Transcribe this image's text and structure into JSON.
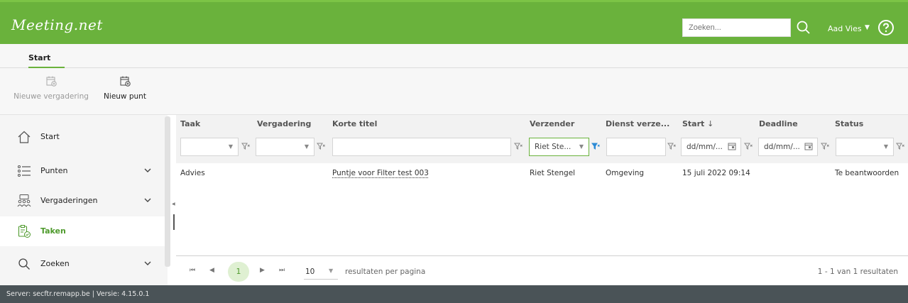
{
  "header": {
    "logo": "Meeting.net",
    "search_placeholder": "Zoeken...",
    "user_name": "Aad Vies",
    "brand_color": "#6ab23c"
  },
  "ribbon": {
    "tab": "Start",
    "buttons": [
      {
        "label": "Nieuwe vergadering",
        "enabled": false,
        "icon": "calendar-add-icon"
      },
      {
        "label": "Nieuw punt",
        "enabled": true,
        "icon": "calendar-add-icon"
      }
    ]
  },
  "sidebar": {
    "items": [
      {
        "label": "Start",
        "icon": "home-icon",
        "expandable": false
      },
      {
        "label": "Punten",
        "icon": "list-icon",
        "expandable": true
      },
      {
        "label": "Vergaderingen",
        "icon": "people-icon",
        "expandable": true
      },
      {
        "label": "Taken",
        "icon": "clipboard-check-icon",
        "expandable": false,
        "active": true
      },
      {
        "label": "Zoeken",
        "icon": "search-icon",
        "expandable": true
      }
    ]
  },
  "grid": {
    "columns": [
      "Taak",
      "Vergadering",
      "Korte titel",
      "Verzender",
      "Dienst verze...",
      "Start",
      "Deadline",
      "Status"
    ],
    "sort_indicator": "↓",
    "filters": {
      "verzender_value": "Riet Ste...",
      "start_placeholder": "dd/mm/...",
      "deadline_placeholder": "dd/mm/..."
    },
    "rows": [
      {
        "taak": "Advies",
        "vergadering": "",
        "korte_titel": "Puntje voor Filter test 003",
        "verzender": "Riet Stengel",
        "dienst": "Omgeving",
        "start": "15 juli 2022 09:14",
        "deadline": "",
        "status": "Te beantwoorden"
      }
    ]
  },
  "pager": {
    "current_page": "1",
    "page_size": "10",
    "page_size_label": "resultaten per pagina",
    "info": "1 - 1 van 1 resultaten"
  },
  "footer": {
    "text": "Server: secftr.remapp.be | Versie: 4.15.0.1"
  }
}
